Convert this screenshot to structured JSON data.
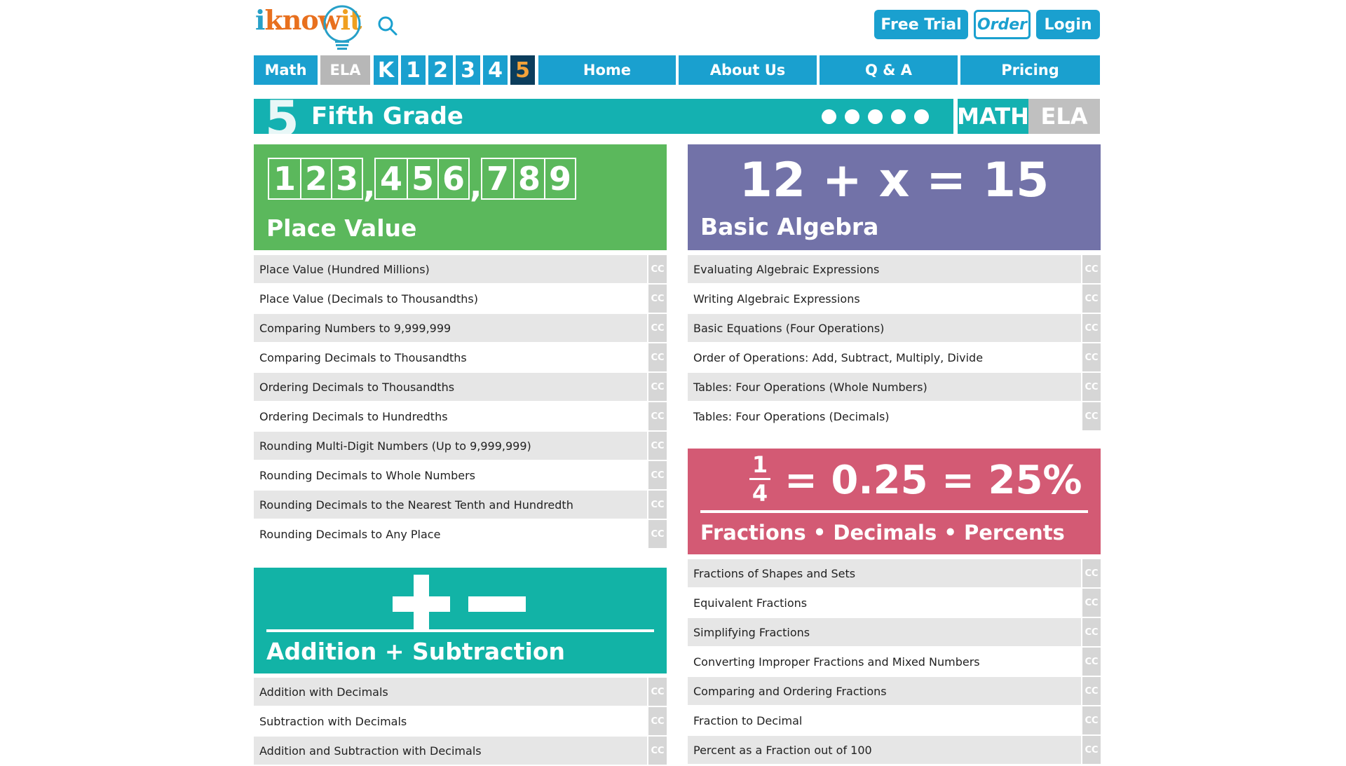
{
  "header": {
    "logo": {
      "part1": "i",
      "part2": "know",
      "part3": "it"
    },
    "buttons": {
      "free_trial": "Free Trial",
      "order": "Order",
      "login": "Login"
    }
  },
  "nav": {
    "subjects": {
      "math": "Math",
      "ela": "ELA"
    },
    "grades": [
      "K",
      "1",
      "2",
      "3",
      "4",
      "5"
    ],
    "selected_grade": "5",
    "links": {
      "home": "Home",
      "about": "About Us",
      "qa": "Q & A",
      "pricing": "Pricing"
    }
  },
  "banner": {
    "grade_number": "5",
    "title": "Fifth Grade",
    "subject_math": "MATH",
    "subject_ela": "ELA"
  },
  "categories": {
    "place_value": {
      "title": "Place Value",
      "digit_groups": [
        [
          "1",
          "2",
          "3"
        ],
        [
          "4",
          "5",
          "6"
        ],
        [
          "7",
          "8",
          "9"
        ]
      ],
      "comma": ",",
      "color": "#5bb85c",
      "skills": [
        "Place Value (Hundred Millions)",
        "Place Value (Decimals to Thousandths)",
        "Comparing Numbers to 9,999,999",
        "Comparing Decimals to Thousandths",
        "Ordering Decimals to Thousandths",
        "Ordering Decimals to Hundredths",
        "Rounding Multi-Digit Numbers (Up to 9,999,999)",
        "Rounding Decimals to Whole Numbers",
        "Rounding Decimals to the Nearest Tenth and Hundredth",
        "Rounding Decimals to Any Place"
      ]
    },
    "basic_algebra": {
      "title": "Basic Algebra",
      "equation": "12 + x = 15",
      "color": "#7272a8",
      "skills": [
        "Evaluating Algebraic Expressions",
        "Writing Algebraic Expressions",
        "Basic Equations (Four Operations)",
        "Order of Operations: Add, Subtract, Multiply, Divide",
        "Tables: Four Operations (Whole Numbers)",
        "Tables: Four Operations (Decimals)"
      ]
    },
    "fractions": {
      "title": "Fractions • Decimals • Percents",
      "numerator": "1",
      "denominator": "4",
      "equation_rest": "= 0.25 = 25%",
      "color": "#d35a74",
      "skills": [
        "Fractions of Shapes and Sets",
        "Equivalent Fractions",
        "Simplifying Fractions",
        "Converting Improper Fractions and Mixed Numbers",
        "Comparing and Ordering Fractions",
        "Fraction to Decimal",
        "Percent as a Fraction out of 100"
      ]
    },
    "addition_subtraction": {
      "title": "Addition + Subtraction",
      "color": "#12b3a6",
      "skills": [
        "Addition with Decimals",
        "Subtraction with Decimals",
        "Addition and Subtraction with Decimals"
      ]
    }
  },
  "cc_label": "CC",
  "colors": {
    "accent": "#1aa0cf",
    "banner": "#14b1b1",
    "selected_grade_bg": "#0b3d5c",
    "selected_grade_text": "#f2a23a"
  },
  "icons": {
    "search": "search-icon",
    "logo_bulb": "lightbulb-icon"
  }
}
